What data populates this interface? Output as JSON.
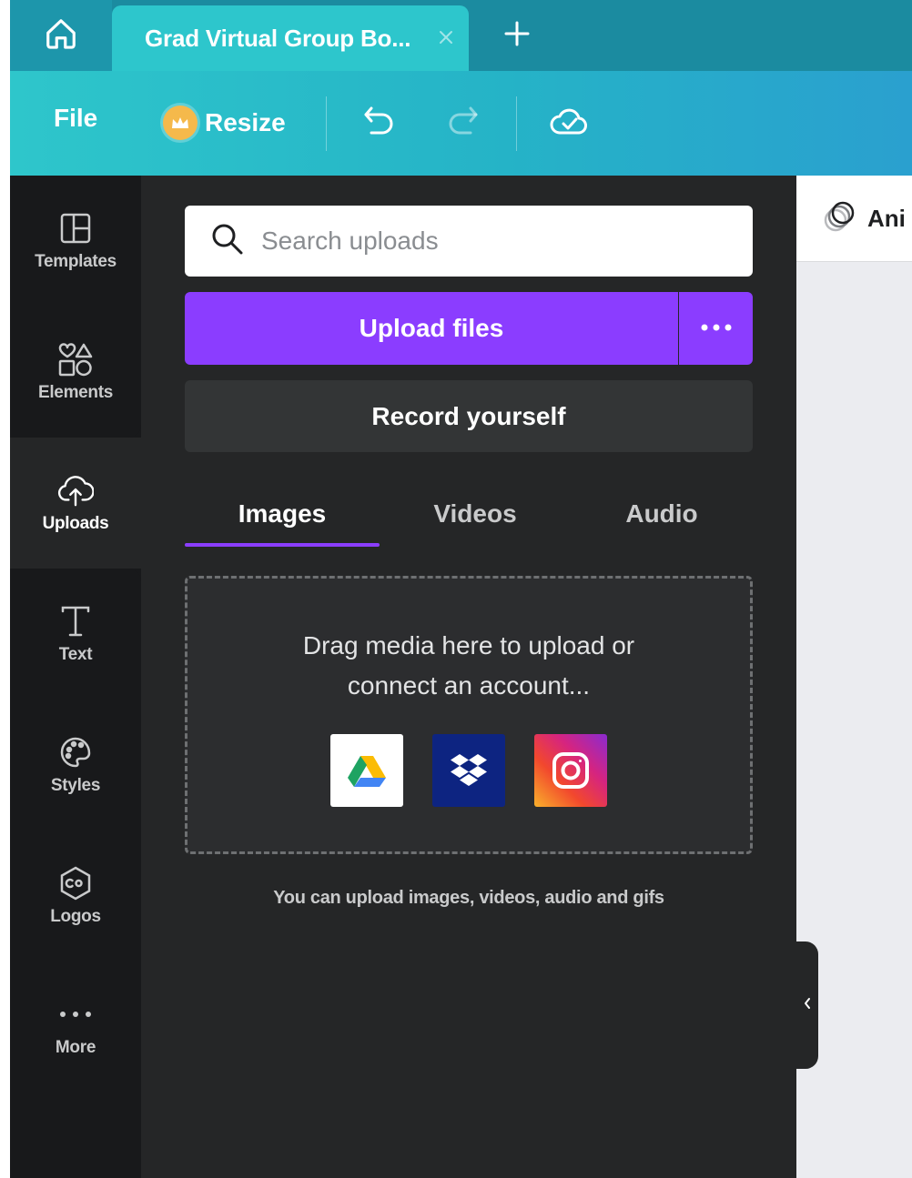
{
  "app": {
    "tab_title": "Grad Virtual Group Bo...",
    "home_icon": "home-icon",
    "close_icon": "close-icon",
    "new_tab_icon": "plus-icon"
  },
  "toolbar": {
    "file_label": "File",
    "resize_label": "Resize",
    "undo_icon": "undo-icon",
    "redo_icon": "redo-icon",
    "saved_icon": "cloud-check-icon"
  },
  "sidebar": {
    "items": [
      {
        "label": "Templates",
        "icon": "templates-icon"
      },
      {
        "label": "Elements",
        "icon": "elements-icon"
      },
      {
        "label": "Uploads",
        "icon": "cloud-upload-icon",
        "active": true
      },
      {
        "label": "Text",
        "icon": "text-icon"
      },
      {
        "label": "Styles",
        "icon": "palette-icon"
      },
      {
        "label": "Logos",
        "icon": "logo-icon"
      },
      {
        "label": "More",
        "icon": "more-icon"
      }
    ]
  },
  "panel": {
    "search": {
      "placeholder": "Search uploads",
      "value": ""
    },
    "upload_button": "Upload files",
    "record_button": "Record yourself",
    "tabs": [
      {
        "label": "Images",
        "active": true
      },
      {
        "label": "Videos"
      },
      {
        "label": "Audio"
      }
    ],
    "drop_zone": {
      "line1": "Drag media here to upload or",
      "line2": "connect an account...",
      "services": [
        "google-drive-icon",
        "dropbox-icon",
        "instagram-icon"
      ]
    },
    "hint": "You can upload images, videos, audio and gifs"
  },
  "canvas": {
    "animate_label": "Ani"
  },
  "colors": {
    "accent": "#8b3dff",
    "toolbar_start": "#2ec6cb",
    "toolbar_end": "#2aa0cf",
    "panel_bg": "#252627",
    "nav_bg": "#18191b"
  }
}
